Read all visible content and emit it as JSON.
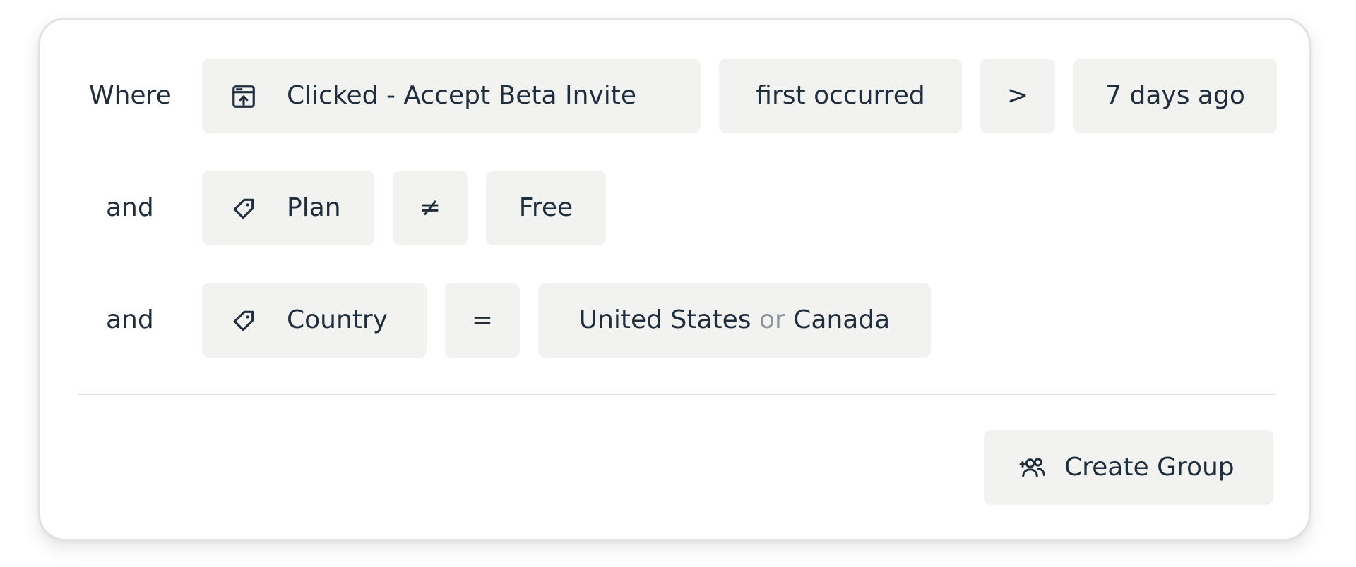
{
  "filters": {
    "rows": [
      {
        "connector": "Where",
        "subject": {
          "label": "Clicked - Accept Beta Invite",
          "icon": "event-icon"
        },
        "operator": "first occurred",
        "comparator": ">",
        "value": "7 days ago"
      },
      {
        "connector": "and",
        "subject": {
          "label": "Plan",
          "icon": "tag-icon"
        },
        "operator": "≠",
        "value": "Free"
      },
      {
        "connector": "and",
        "subject": {
          "label": "Country",
          "icon": "tag-icon"
        },
        "operator": "=",
        "value": {
          "first": "United States",
          "joiner": "or",
          "second": "Canada"
        }
      }
    ]
  },
  "actions": {
    "create_group": {
      "label": "Create Group",
      "icon": "users-icon"
    }
  },
  "colors": {
    "chip_bg": "#f2f2f1",
    "text": "#1f2d3d",
    "muted": "#8d959c",
    "border": "#e2e2e2"
  }
}
